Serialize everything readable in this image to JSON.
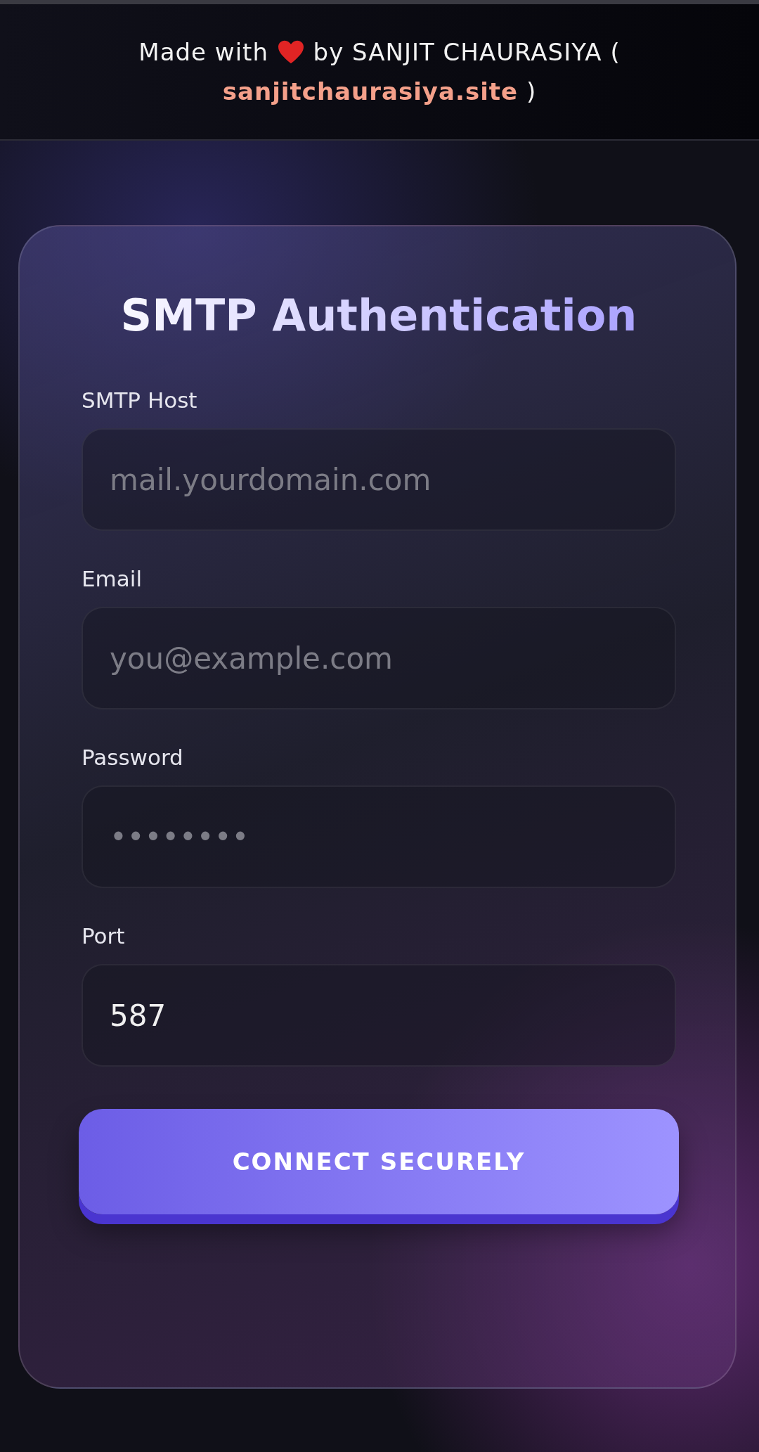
{
  "credit": {
    "prefix": "Made with",
    "suffix": "by SANJIT CHAURASIYA (",
    "link": "sanjitchaurasiya.site",
    "close": ")"
  },
  "form": {
    "title": "SMTP Authentication",
    "fields": [
      {
        "label": "SMTP Host",
        "placeholder": "mail.yourdomain.com"
      },
      {
        "label": "Email",
        "placeholder": "you@example.com"
      },
      {
        "label": "Password",
        "placeholder": "••••••••"
      },
      {
        "label": "Port",
        "value": "587"
      }
    ],
    "button": "CONNECT SECURELY"
  }
}
